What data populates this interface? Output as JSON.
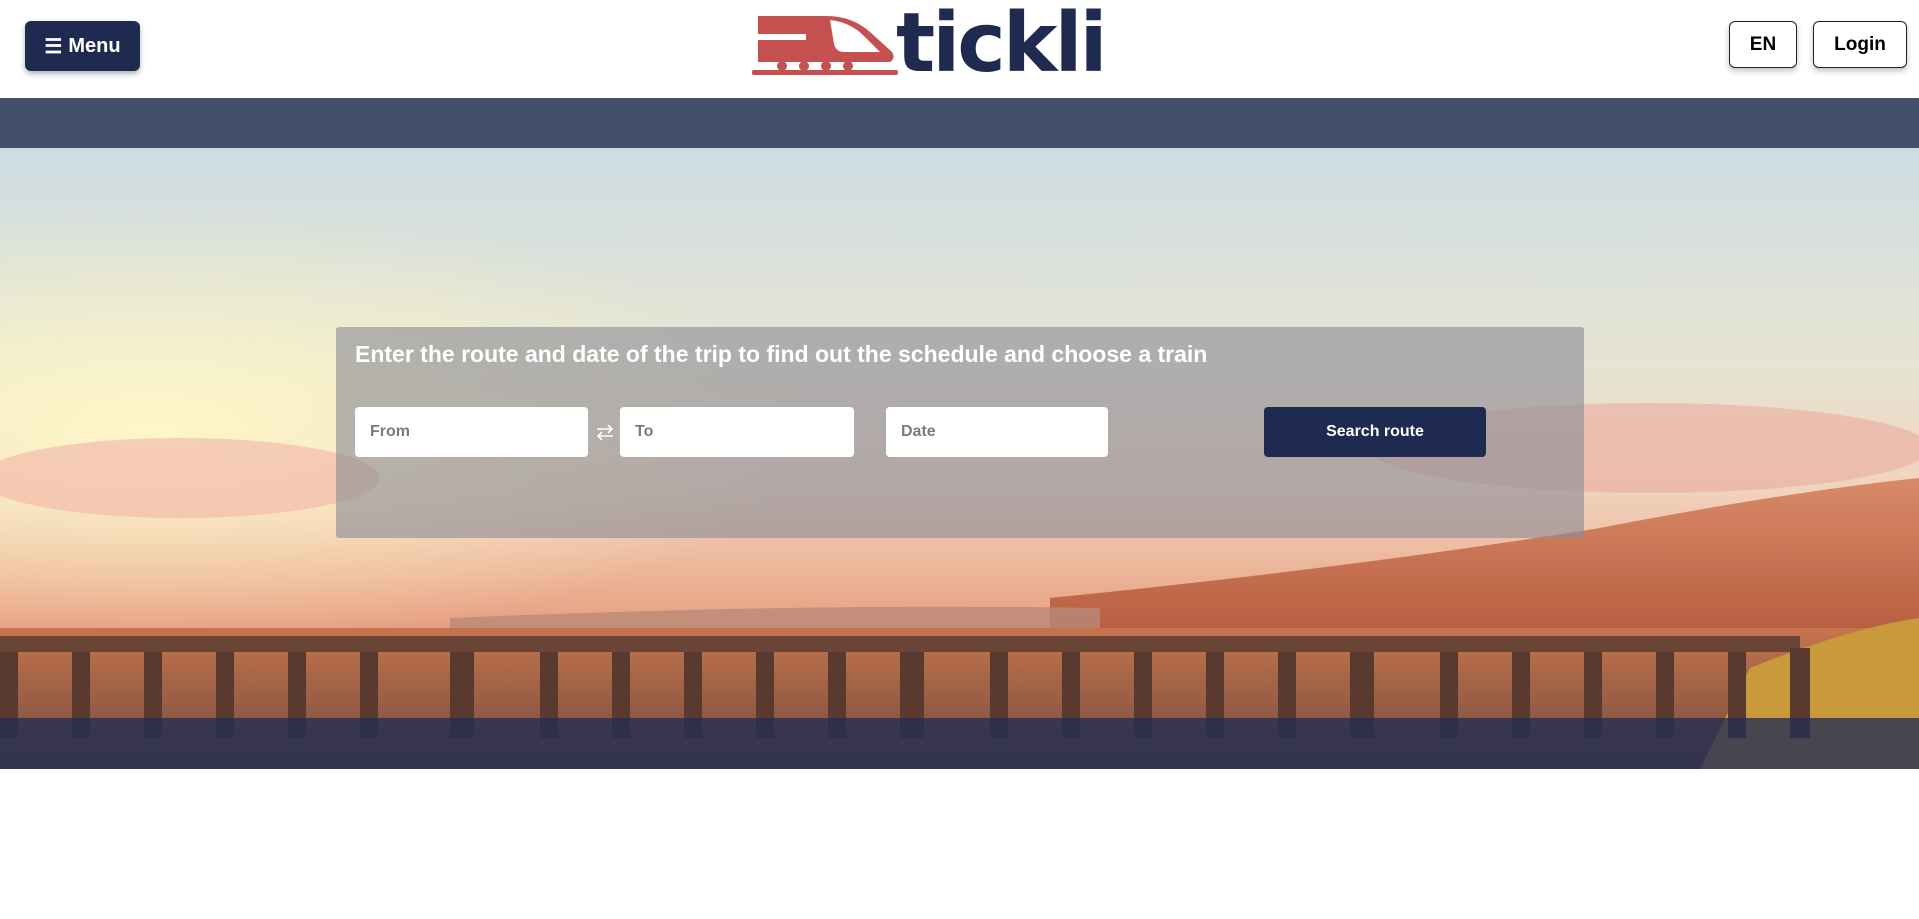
{
  "header": {
    "menu_label": "Menu",
    "menu_icon": "hamburger-icon",
    "logo_text": "tickli",
    "logo_icon": "train-icon",
    "language": "EN",
    "login_label": "Login"
  },
  "search": {
    "title": "Enter the route and date of the trip to find out the schedule and choose a train",
    "from_placeholder": "From",
    "to_placeholder": "To",
    "date_placeholder": "Date",
    "swap_icon": "swap-arrows-icon",
    "submit_label": "Search route"
  },
  "colors": {
    "brand_navy": "#1e2a4f",
    "brand_red": "#c55050",
    "nav_band": "#43506c"
  }
}
